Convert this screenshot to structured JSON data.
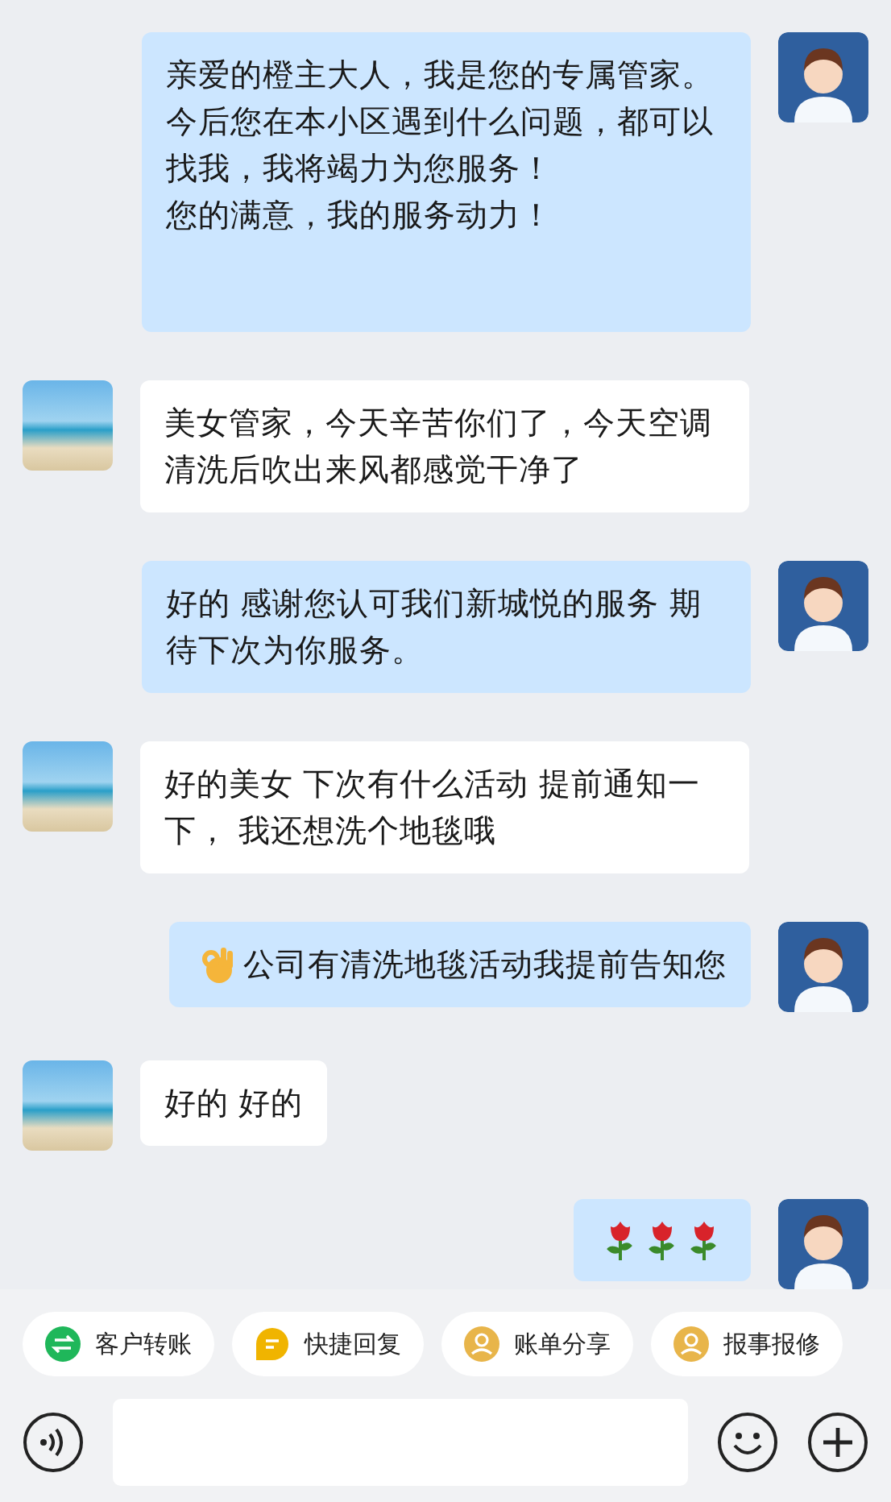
{
  "messages": [
    {
      "kind": "sent",
      "paragraphs": [
        "亲爱的橙主大人，我是您的专属管家。今后您在本小区遇到什么问题，都可以找我，我将竭力为您服务！",
        "您的满意，我的服务动力！"
      ]
    },
    {
      "kind": "received",
      "text": "美女管家，今天辛苦你们了，今天空调清洗后吹出来风都感觉干净了"
    },
    {
      "kind": "sent",
      "text": "好的 感谢您认可我们新城悦的服务 期待下次为你服务。"
    },
    {
      "kind": "received",
      "text": "好的美女 下次有什么活动 提前通知一下， 我还想洗个地毯哦"
    },
    {
      "kind": "sent-ok",
      "text": "公司有清洗地毯活动我提前告知您"
    },
    {
      "kind": "received",
      "text": "好的 好的"
    },
    {
      "kind": "sent-roses"
    }
  ],
  "quick_actions": [
    {
      "kind": "transfer",
      "label": "客户转账"
    },
    {
      "kind": "reply",
      "label": "快捷回复"
    },
    {
      "kind": "person",
      "label": "账单分享"
    },
    {
      "kind": "person",
      "label": "报事报修"
    }
  ]
}
